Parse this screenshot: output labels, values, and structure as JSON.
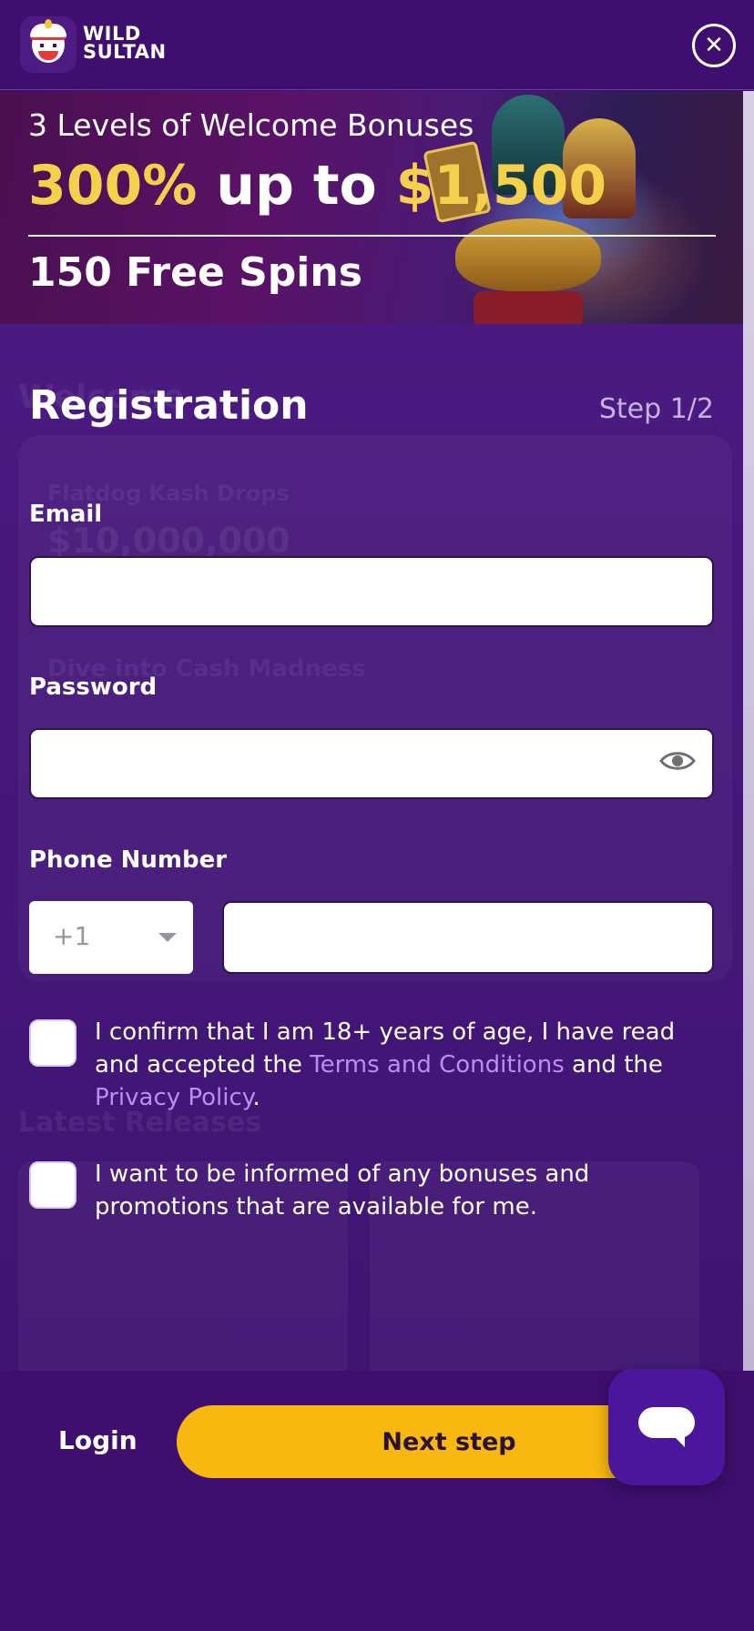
{
  "header": {
    "logo_line1": "WILD",
    "logo_line2": "SULTAN",
    "close_symbol": "✕"
  },
  "banner": {
    "line1": "3 Levels of Welcome Bonuses",
    "percent": "300%",
    "up_to": " up to ",
    "amount": "$1,500",
    "line3": "150 Free Spins"
  },
  "background": {
    "ghost_title": "Welcome",
    "ghost_promo": "Flatdog Kash Drops",
    "ghost_amount": "$10,000,000",
    "ghost_dive": "Dive into Cash Madness",
    "ghost_latest": "Latest Releases"
  },
  "registration": {
    "title": "Registration",
    "step": "Step 1/2",
    "email_label": "Email",
    "email_value": "",
    "password_label": "Password",
    "password_value": "",
    "phone_label": "Phone Number",
    "country_code": "+1",
    "phone_value": "",
    "age_text_1": "I confirm that I am 18+ years of age, I have read and accepted the ",
    "terms_link": "Terms and Conditions",
    "age_text_2": " and the ",
    "privacy_link": "Privacy Policy",
    "age_text_3": ".",
    "promo_text": "I want to be informed of any bonuses and promotions that are available for me."
  },
  "footer": {
    "login_label": "Login",
    "next_label": "Next step"
  },
  "colors": {
    "background": "#3d1170",
    "accent_gold": "#f5d04a",
    "button": "#f8b80f",
    "link": "#b78ff0"
  }
}
